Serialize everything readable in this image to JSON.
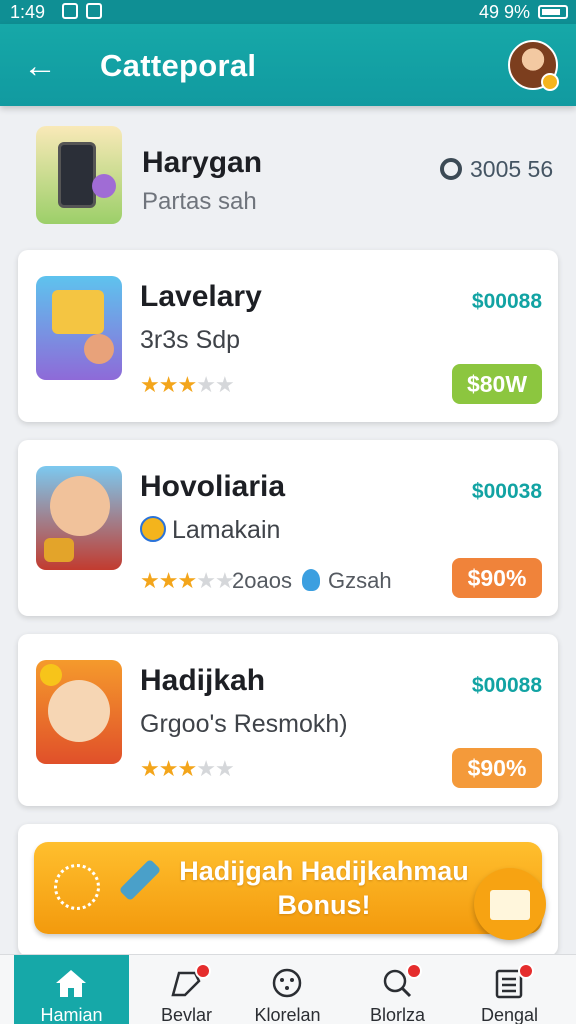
{
  "status_bar": {
    "time": "1:49",
    "battery": "49 9%"
  },
  "app_bar": {
    "title": "Catteporal"
  },
  "top_item": {
    "title": "Harygan",
    "subtitle": "Partas sah",
    "stat": "3005 56"
  },
  "cards": [
    {
      "title": "Lavelary",
      "subtitle": "3r3s Sdp",
      "price": "$00088",
      "rating": 3,
      "pill": "$80W",
      "pill_color": "#8cc63f"
    },
    {
      "title": "Hovoliaria",
      "subtitle": "Lamakain",
      "price": "$00038",
      "rating": 3,
      "stat1": "2oaos",
      "stat2": "Gzsah",
      "pill": "$90%",
      "pill_color": "#f0833a"
    },
    {
      "title": "Hadijkah",
      "subtitle": "Grgoo's Resmokh)",
      "price": "$00088",
      "rating": 3,
      "pill": "$90%",
      "pill_color": "#f49a3a"
    }
  ],
  "bonus": {
    "line1": "Hadijgah Hadijkahmau",
    "line2": "Bonus!"
  },
  "nav": [
    {
      "label": "Hamian",
      "icon": "home-icon",
      "badge": false
    },
    {
      "label": "Bevlar",
      "icon": "tag-icon",
      "badge": true
    },
    {
      "label": "Klorelan",
      "icon": "smiley-icon",
      "badge": false
    },
    {
      "label": "Blorlza",
      "icon": "search-icon",
      "badge": true
    },
    {
      "label": "Dengal",
      "icon": "list-icon",
      "badge": true
    }
  ]
}
